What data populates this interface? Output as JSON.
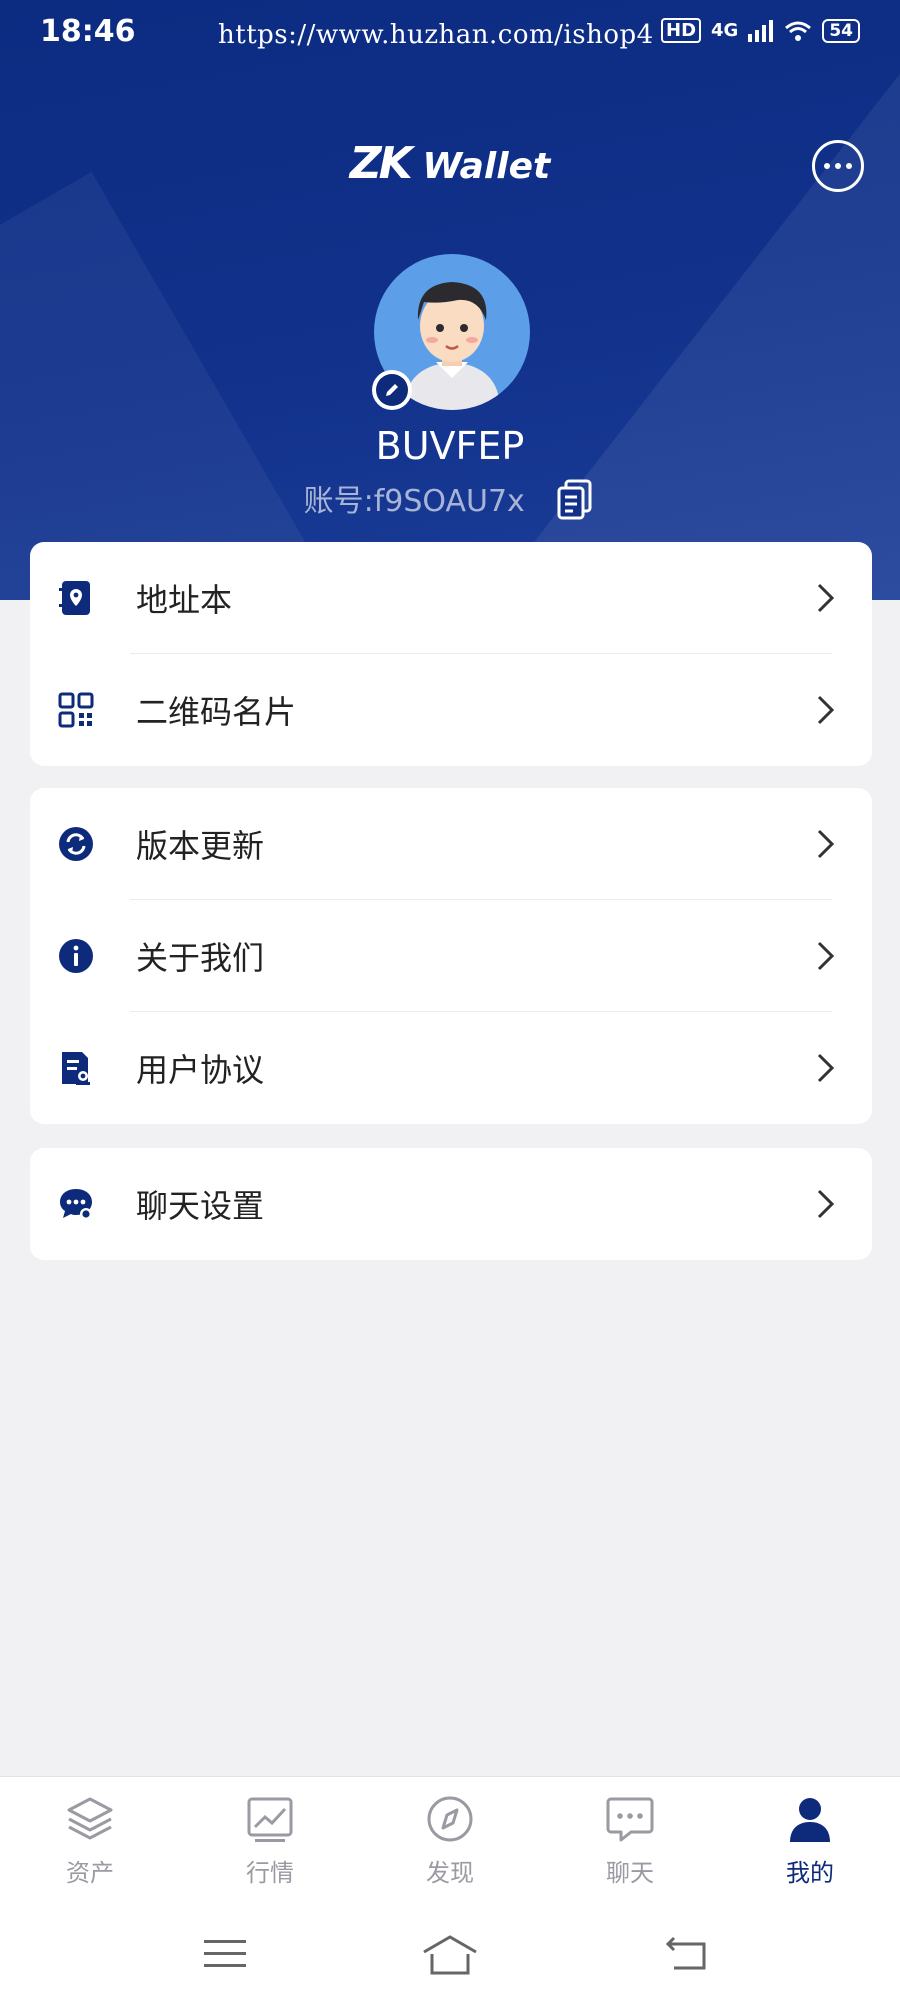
{
  "status_bar": {
    "time": "18:46",
    "url": "https://www.huzhan.com/ishop4",
    "network": "4G",
    "hd": "HD",
    "battery": "54"
  },
  "header": {
    "brand": "Wallet",
    "brand_mark": "ZK"
  },
  "profile": {
    "nickname": "BUVFEP",
    "account": "账号:f9SOAU7x"
  },
  "menu_groups": [
    {
      "items": [
        {
          "label": "地址本",
          "icon": "address-book-icon"
        },
        {
          "label": "二维码名片",
          "icon": "qr-code-icon"
        }
      ]
    },
    {
      "items": [
        {
          "label": "版本更新",
          "icon": "refresh-icon"
        },
        {
          "label": "关于我们",
          "icon": "info-icon"
        },
        {
          "label": "用户协议",
          "icon": "agreement-icon"
        }
      ]
    },
    {
      "items": [
        {
          "label": "聊天设置",
          "icon": "chat-settings-icon"
        }
      ]
    }
  ],
  "tabbar": {
    "tabs": [
      {
        "label": "资产",
        "icon": "layers-icon",
        "active": false
      },
      {
        "label": "行情",
        "icon": "chart-icon",
        "active": false
      },
      {
        "label": "发现",
        "icon": "compass-icon",
        "active": false
      },
      {
        "label": "聊天",
        "icon": "chat-icon",
        "active": false
      },
      {
        "label": "我的",
        "icon": "user-icon",
        "active": true
      }
    ]
  },
  "colors": {
    "primary": "#0e2a7a",
    "background": "#f1f1f3"
  }
}
